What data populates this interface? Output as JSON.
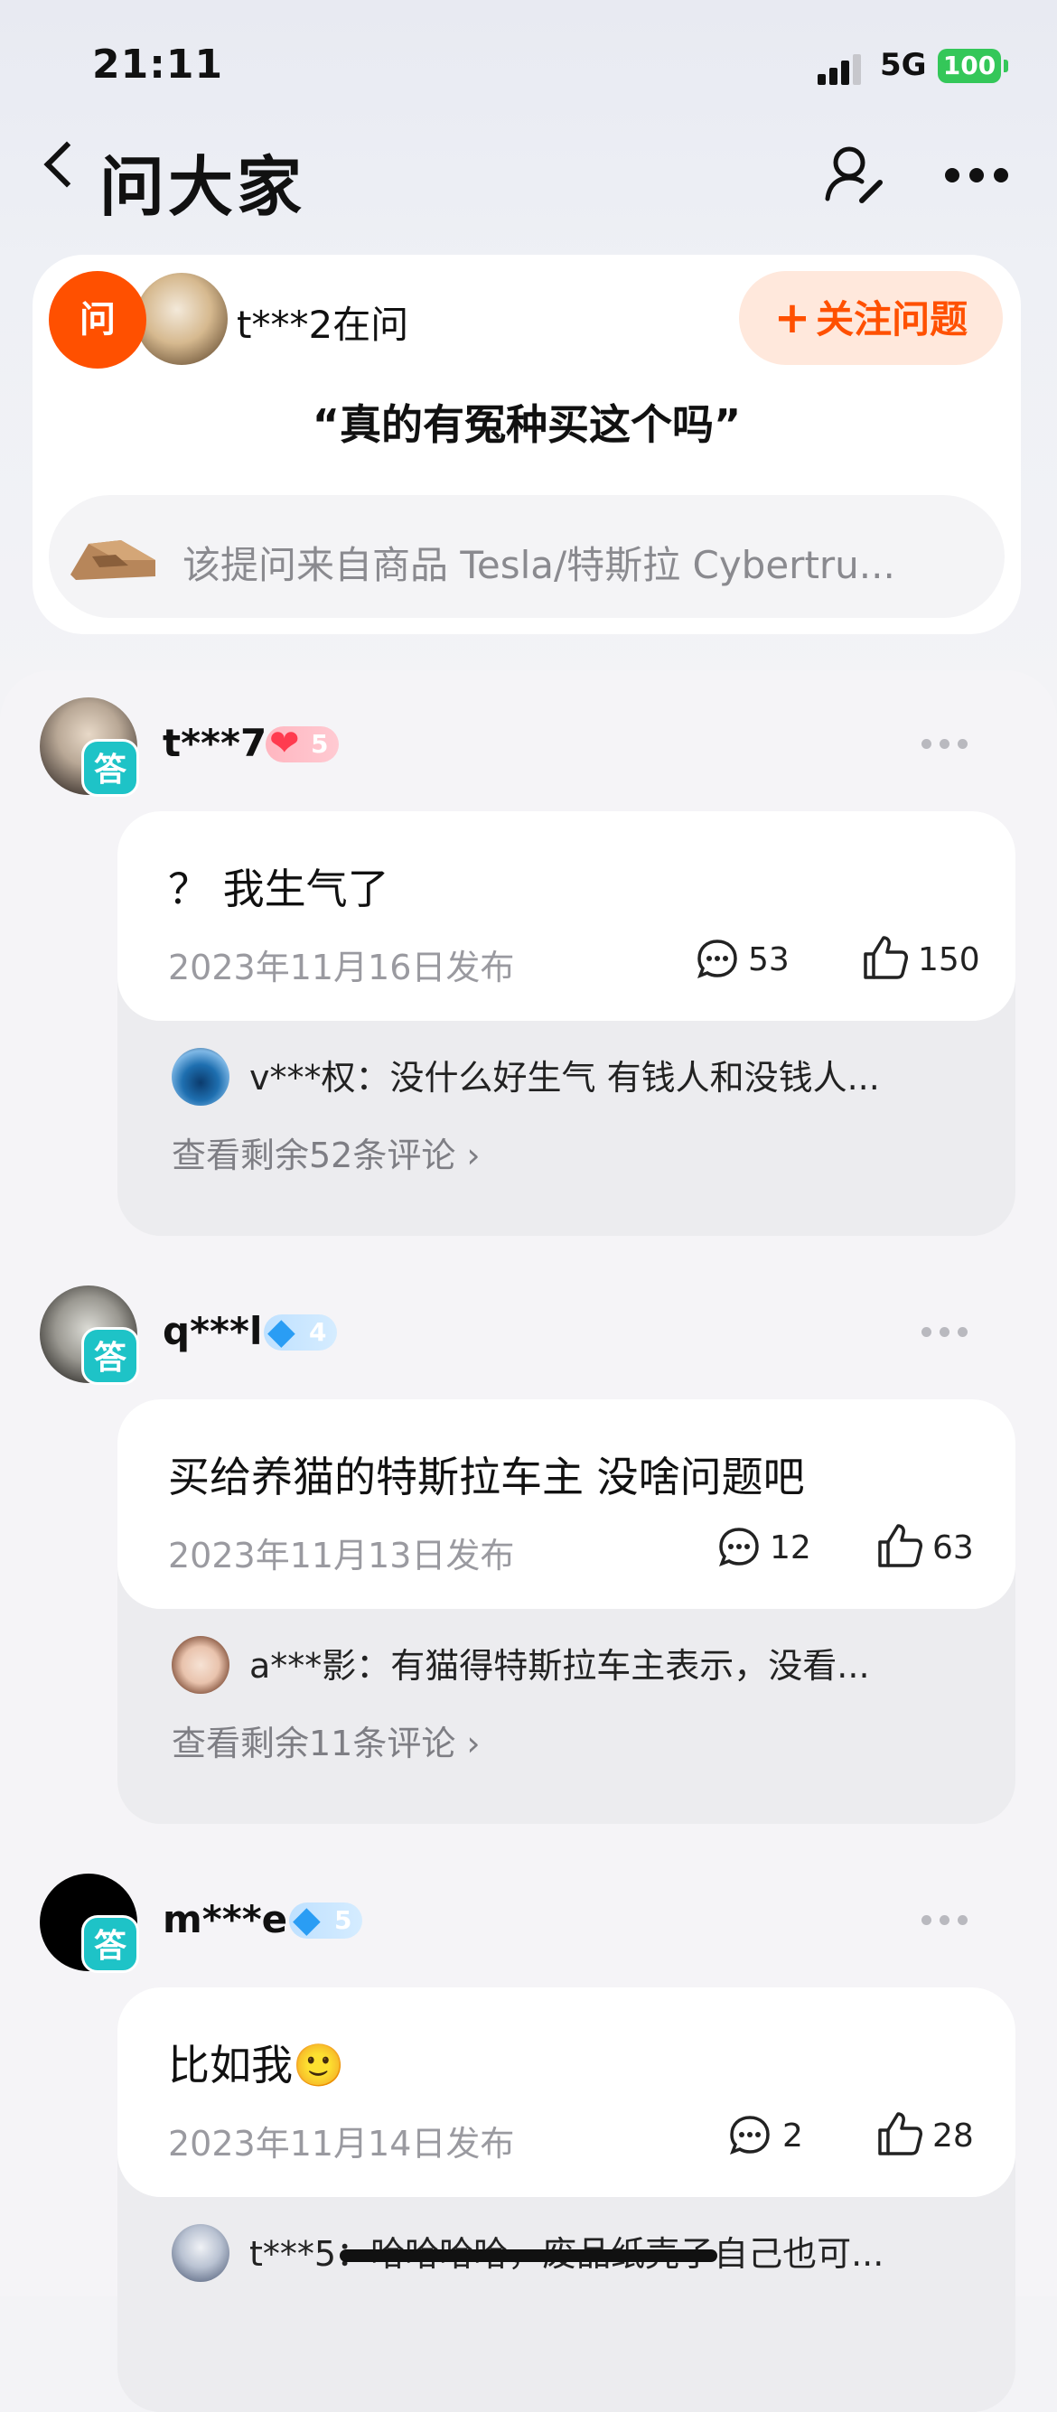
{
  "status_bar": {
    "time": "21:11",
    "network": "5G",
    "battery": "100"
  },
  "nav": {
    "title": "问大家"
  },
  "question": {
    "ask_badge": "问",
    "asker": "t***2",
    "asker_suffix": "在问",
    "follow_label": "关注问题",
    "title": "“真的有冤种买这个吗”",
    "product_text": "该提问来自商品 Tesla/特斯拉 Cybertru..."
  },
  "answers": [
    {
      "badge": "答",
      "name": "t***7",
      "level": "5",
      "level_type": "heart",
      "text": "？ 我生气了",
      "date": "2023年11月16日发布",
      "comments": "53",
      "likes": "150",
      "top_comment": "v***权：没什么好生气 有钱人和没钱人...",
      "more_comments": "查看剩余52条评论 ›"
    },
    {
      "badge": "答",
      "name": "q***l",
      "level": "4",
      "level_type": "diamond",
      "text": "买给养猫的特斯拉车主 没啥问题吧",
      "date": "2023年11月13日发布",
      "comments": "12",
      "likes": "63",
      "top_comment": "a***影：有猫得特斯拉车主表示，没看...",
      "more_comments": "查看剩余11条评论 ›"
    },
    {
      "badge": "答",
      "name": "m***e",
      "level": "5",
      "level_type": "diamond",
      "text": "比如我🙂",
      "date": "2023年11月14日发布",
      "comments": "2",
      "likes": "28",
      "top_comment": "t***5：哈哈哈哈，废品纸壳子自己也可...",
      "more_comments": ""
    }
  ],
  "colors": {
    "accent": "#ff5000",
    "answer_badge": "#1ec3c7",
    "battery": "#34c759"
  }
}
